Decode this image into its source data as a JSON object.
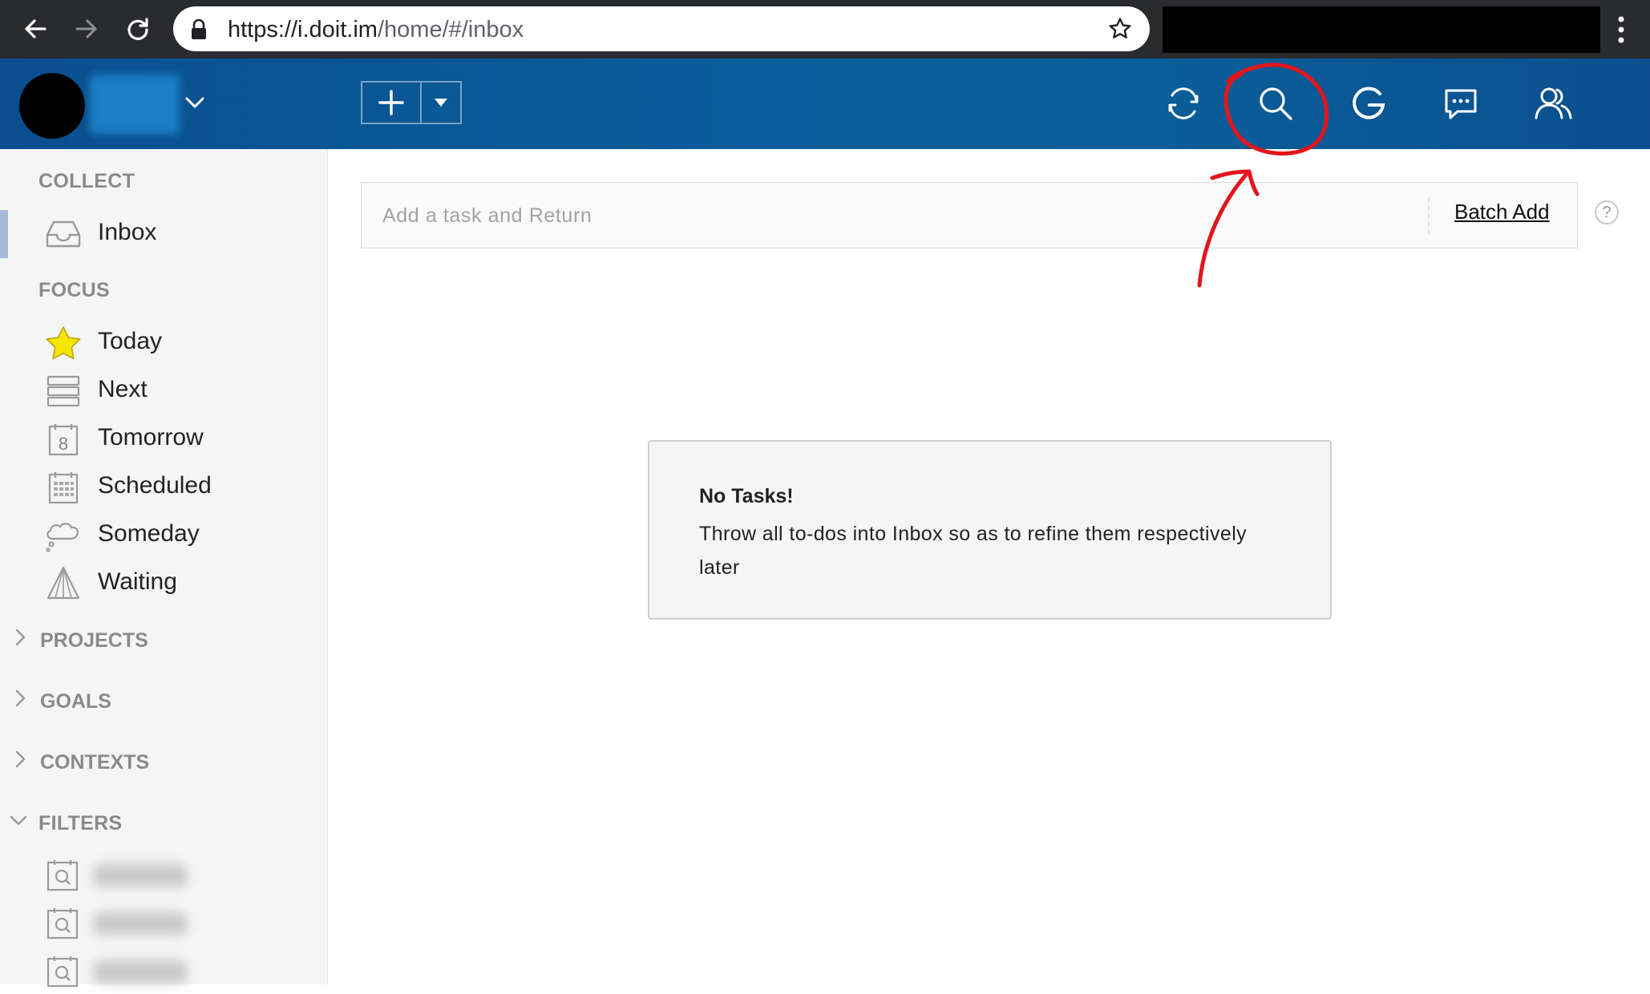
{
  "browser": {
    "url_main": "https://i.doit.im",
    "url_path": "/home/#/inbox",
    "icons": [
      "back-arrow-icon",
      "forward-arrow-icon",
      "reload-icon",
      "lock-icon",
      "bookmark-star-icon",
      "menu-dots-icon"
    ]
  },
  "header": {
    "icons": [
      "add-icon",
      "caret-down-icon",
      "sync-icon",
      "search-icon",
      "google-icon",
      "chat-icon",
      "contacts-icon"
    ]
  },
  "sidebar": {
    "collect_label": "COLLECT",
    "focus_label": "FOCUS",
    "inbox": {
      "label": "Inbox",
      "icon": "inbox-tray-icon"
    },
    "focus_items": [
      {
        "label": "Today",
        "icon": "star-icon"
      },
      {
        "label": "Next",
        "icon": "list-icon"
      },
      {
        "label": "Tomorrow",
        "icon": "calendar-8-icon"
      },
      {
        "label": "Scheduled",
        "icon": "calendar-grid-icon"
      },
      {
        "label": "Someday",
        "icon": "cloud-icon"
      },
      {
        "label": "Waiting",
        "icon": "sail-icon"
      }
    ],
    "projects_label": "PROJECTS",
    "goals_label": "GOALS",
    "contexts_label": "CONTEXTS",
    "filters_label": "FILTERS"
  },
  "main": {
    "task_placeholder": "Add a task and Return",
    "batch_add_label": "Batch Add",
    "help_label": "?",
    "empty_title": "No Tasks!",
    "empty_desc": "Throw all to-dos into Inbox so as to refine them respectively later"
  },
  "colors": {
    "header_blue": "#0a5e9b",
    "annotation_red": "#e3151b",
    "star_yellow": "#f5e300"
  }
}
